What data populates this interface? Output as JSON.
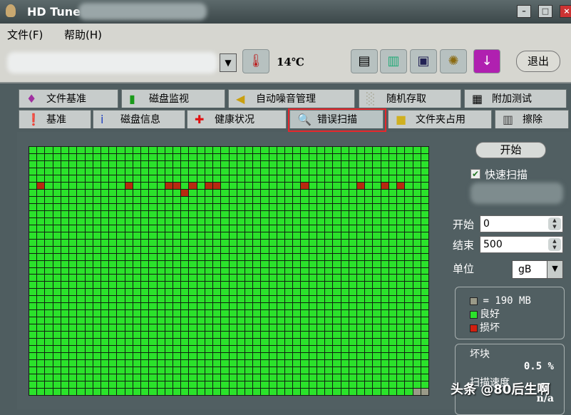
{
  "window": {
    "title": "HD Tune"
  },
  "menu": [
    {
      "label": "文件(F)"
    },
    {
      "label": "帮助(H)"
    }
  ],
  "toolbar": {
    "temperature": "14℃",
    "exit_label": "退出"
  },
  "tabs_row1": [
    {
      "label": "文件基准",
      "icon": "file-benchmark-icon"
    },
    {
      "label": "磁盘监视",
      "icon": "disk-monitor-icon"
    },
    {
      "label": "自动噪音管理",
      "icon": "speaker-icon"
    },
    {
      "label": "随机存取",
      "icon": "random-access-icon"
    },
    {
      "label": "附加测试",
      "icon": "extra-tests-icon"
    }
  ],
  "tabs_row2": [
    {
      "label": "基准",
      "icon": "benchmark-icon"
    },
    {
      "label": "磁盘信息",
      "icon": "info-icon"
    },
    {
      "label": "健康状况",
      "icon": "health-cross-icon"
    },
    {
      "label": "错误扫描",
      "icon": "magnifier-icon",
      "active": true
    },
    {
      "label": "文件夹占用",
      "icon": "folder-icon"
    },
    {
      "label": "擦除",
      "icon": "trash-icon"
    }
  ],
  "scan": {
    "start_button": "开始",
    "quick_scan_label": "快速扫描",
    "quick_scan_checked": true,
    "start_label": "开始",
    "start_value": "0",
    "end_label": "结束",
    "end_value": "500",
    "unit_label": "单位",
    "unit_value": "gB",
    "legend": {
      "block_size": "= 190 MB",
      "good": "良好",
      "damaged": "损坏"
    },
    "damaged_blocks_label": "坏块",
    "damaged_blocks_value": "0.5 %",
    "scan_speed_label": "扫描速度",
    "scan_speed_value": "n/a"
  },
  "grid": {
    "columns": 50,
    "rows": 35,
    "bad_blocks": [
      [
        5,
        1
      ],
      [
        5,
        12
      ],
      [
        5,
        17
      ],
      [
        5,
        18
      ],
      [
        6,
        19
      ],
      [
        5,
        20
      ],
      [
        5,
        22
      ],
      [
        5,
        23
      ],
      [
        5,
        34
      ],
      [
        5,
        41
      ],
      [
        5,
        44
      ],
      [
        5,
        46
      ]
    ],
    "unscanned_blocks": [
      [
        34,
        48
      ],
      [
        34,
        49
      ]
    ]
  },
  "colors": {
    "good": "#2be22b",
    "damaged": "#b82a10",
    "unscanned": "#9a9a88",
    "highlight": "#e8262b"
  },
  "watermark": "头条 @80后生啊"
}
